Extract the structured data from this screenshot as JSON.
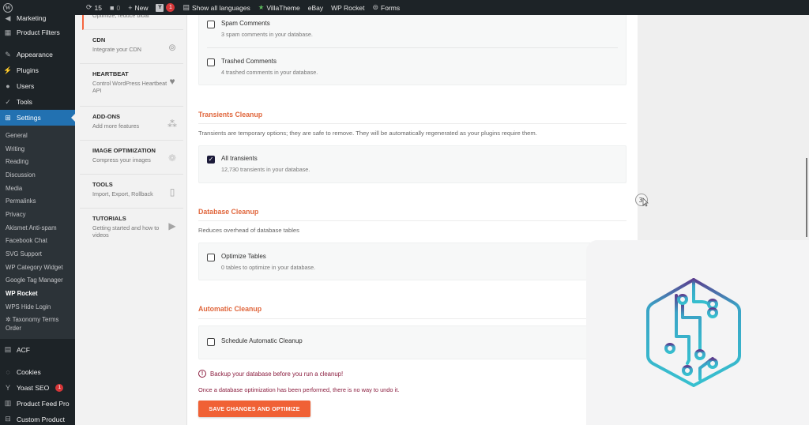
{
  "adminbar": {
    "updates_count": "15",
    "comments_count": "0",
    "new_label": "New",
    "yoast_badge": "1",
    "languages_label": "Show all languages",
    "villatheme_label": "VillaTheme",
    "ebay_label": "eBay",
    "wprocket_label": "WP Rocket",
    "forms_label": "Forms"
  },
  "menu": {
    "top_items": [
      {
        "label": "Marketing",
        "icon": "megaphone-icon"
      },
      {
        "label": "Product Filters",
        "icon": "filter-icon"
      },
      {
        "label": "Appearance",
        "icon": "paintbrush-icon"
      },
      {
        "label": "Plugins",
        "icon": "plugin-icon"
      },
      {
        "label": "Users",
        "icon": "users-icon"
      },
      {
        "label": "Tools",
        "icon": "wrench-icon"
      },
      {
        "label": "Settings",
        "icon": "settings-icon"
      }
    ],
    "settings_submenu": [
      "General",
      "Writing",
      "Reading",
      "Discussion",
      "Media",
      "Permalinks",
      "Privacy",
      "Akismet Anti-spam",
      "Facebook Chat",
      "SVG Support",
      "WP Category Widget",
      "Google Tag Manager",
      "WP Rocket",
      "WPS Hide Login",
      "Taxonomy Terms Order"
    ],
    "bottom_items": [
      {
        "label": "ACF",
        "icon": "acf-icon"
      },
      {
        "label": "Cookies",
        "icon": "cookie-icon"
      },
      {
        "label": "Yoast SEO",
        "icon": "yoast-icon",
        "badge": "1"
      },
      {
        "label": "Product Feed Pro",
        "icon": "feed-icon"
      },
      {
        "label": "Custom Product",
        "icon": "grid-icon"
      }
    ]
  },
  "rocket_nav": {
    "first_desc": "Optimize, reduce bloat",
    "items": [
      {
        "title": "CDN",
        "desc": "Integrate your CDN",
        "icon": "cdn-icon"
      },
      {
        "title": "HEARTBEAT",
        "desc": "Control WordPress Heartbeat API",
        "icon": "heartbeat-icon"
      },
      {
        "title": "ADD-ONS",
        "desc": "Add more features",
        "icon": "addons-icon"
      },
      {
        "title": "IMAGE OPTIMIZATION",
        "desc": "Compress your images",
        "icon": "image-optimization-icon"
      },
      {
        "title": "TOOLS",
        "desc": "Import, Export, Rollback",
        "icon": "tools-icon"
      },
      {
        "title": "TUTORIALS",
        "desc": "Getting started and how to videos",
        "icon": "video-icon"
      }
    ]
  },
  "main": {
    "comments": [
      {
        "label": "Spam Comments",
        "desc": "3 spam comments in your database.",
        "checked": false
      },
      {
        "label": "Trashed Comments",
        "desc": "4 trashed comments in your database.",
        "checked": false
      }
    ],
    "transients": {
      "title": "Transients Cleanup",
      "desc": "Transients are temporary options; they are safe to remove. They will be automatically regenerated as your plugins require them.",
      "option": {
        "label": "All transients",
        "desc": "12,730 transients in your database.",
        "checked": true
      }
    },
    "database": {
      "title": "Database Cleanup",
      "desc": "Reduces overhead of database tables",
      "option": {
        "label": "Optimize Tables",
        "desc": "0 tables to optimize in your database.",
        "checked": false
      }
    },
    "automatic": {
      "title": "Automatic Cleanup",
      "option": {
        "label": "Schedule Automatic Cleanup",
        "checked": false
      }
    },
    "warning": "Backup your database before you run a cleanup!",
    "note": "Once a database optimization has been performed, there is no way to undo it.",
    "save_label": "SAVE CHANGES AND OPTIMIZE"
  },
  "colors": {
    "accent": "#f06135",
    "section_title": "#e0663c",
    "warning": "#8b1e3f",
    "admin_active": "#2271b1"
  }
}
